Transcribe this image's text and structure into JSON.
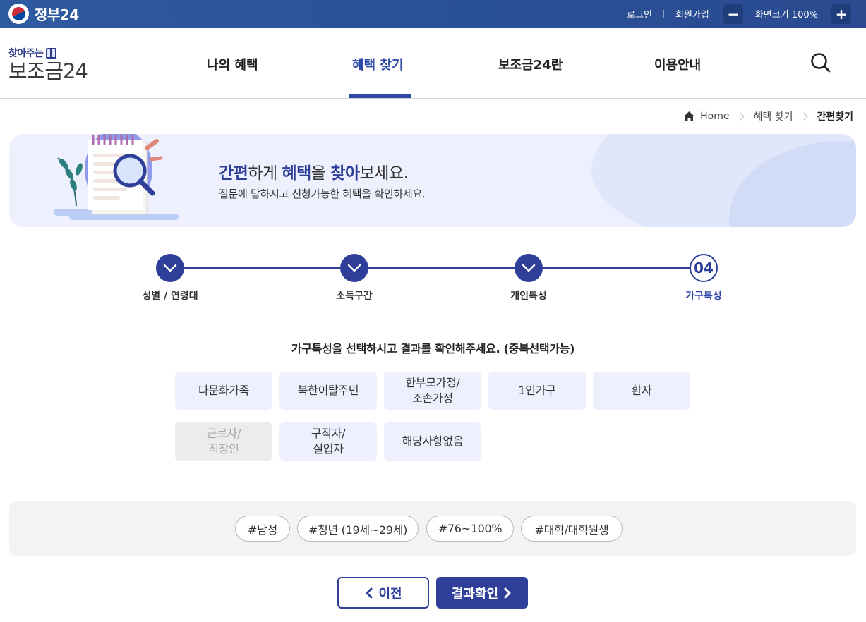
{
  "gov_bar": {
    "site_name": "정부24",
    "login": "로그인",
    "signup": "회원가입",
    "zoom_label": "화면크기 100%",
    "zoom_out": "−",
    "zoom_in": "+"
  },
  "brand": {
    "tagline": "찾아주는",
    "name": "보조금24"
  },
  "nav": {
    "items": [
      {
        "label": "나의 혜택"
      },
      {
        "label": "혜택 찾기"
      },
      {
        "label": "보조금24란"
      },
      {
        "label": "이용안내"
      }
    ],
    "active_index": 1
  },
  "breadcrumb": {
    "home": "Home",
    "level1": "혜택 찾기",
    "current": "간편찾기"
  },
  "banner": {
    "t1": "간편",
    "t2": "하게 ",
    "t3": "혜택",
    "t4": "을 ",
    "t5": "찾아",
    "t6": "보세요.",
    "subtitle": "질문에 답하시고 신청가능한 혜택을 확인하세요."
  },
  "steps": [
    {
      "label": "성별 / 연령대",
      "status": "done"
    },
    {
      "label": "소득구간",
      "status": "done"
    },
    {
      "label": "개인특성",
      "status": "done"
    },
    {
      "label": "가구특성",
      "status": "current",
      "number": "04"
    }
  ],
  "question": "가구특성을 선택하시고 결과를 확인해주세요. (중복선택가능)",
  "options": [
    {
      "label": "다문화가족",
      "disabled": false
    },
    {
      "label": "북한이탈주민",
      "disabled": false
    },
    {
      "label": "한부모가정/\n조손가정",
      "disabled": false
    },
    {
      "label": "1인가구",
      "disabled": false
    },
    {
      "label": "환자",
      "disabled": false
    },
    {
      "label": "근로자/\n직장인",
      "disabled": true
    },
    {
      "label": "구직자/\n실업자",
      "disabled": false
    },
    {
      "label": "해당사항없음",
      "disabled": false
    }
  ],
  "tags": [
    "#남성",
    "#청년 (19세~29세)",
    "#76~100%",
    "#대학/대학원생"
  ],
  "buttons": {
    "prev": "이전",
    "next": "결과확인"
  },
  "colors": {
    "primary": "#2f3f99",
    "option_bg": "#eef1fd",
    "disabled_bg": "#ececec"
  }
}
